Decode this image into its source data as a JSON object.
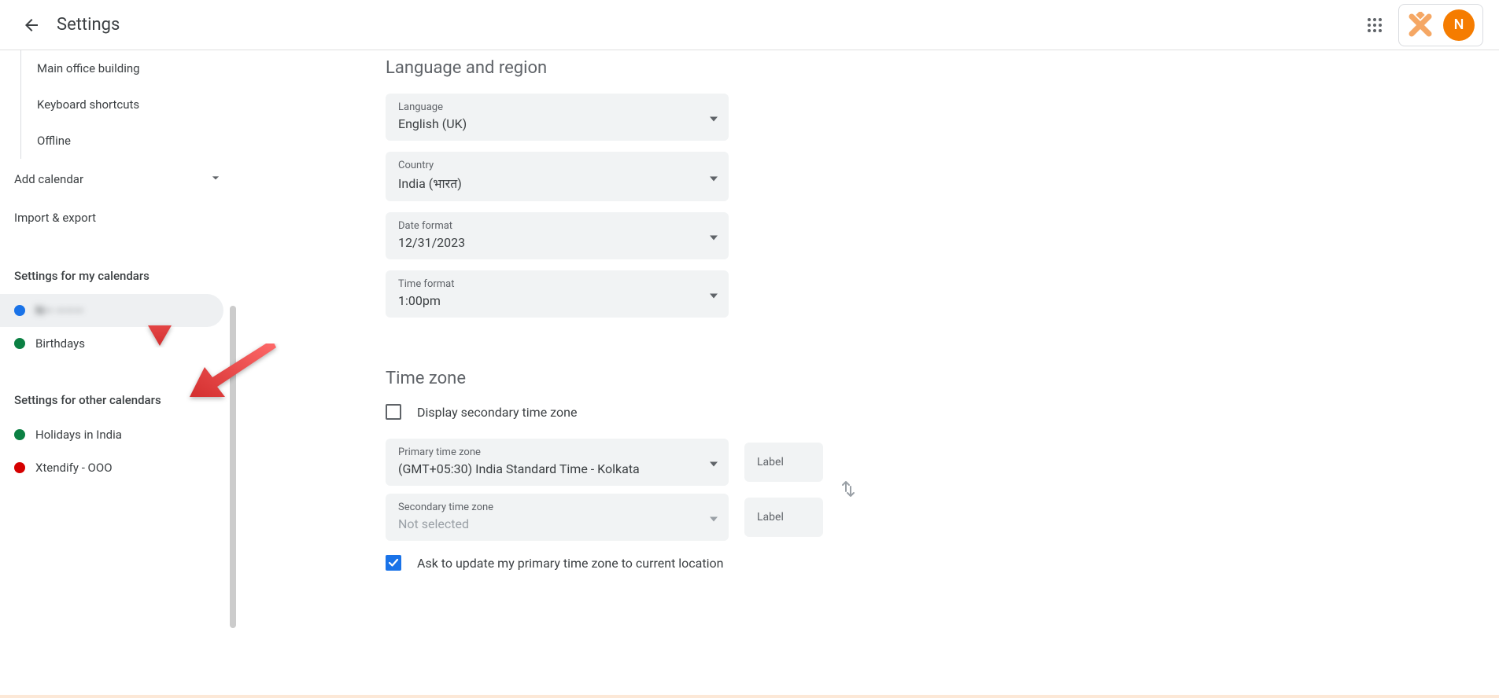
{
  "header": {
    "title": "Settings",
    "avatar_letter": "N"
  },
  "sidebar": {
    "general_items": [
      "Main office building",
      "Keyboard shortcuts",
      "Offline"
    ],
    "add_calendar": "Add calendar",
    "import_export": "Import & export",
    "my_cal_heading": "Settings for my calendars",
    "my_calendars": [
      {
        "label": "N—  ———",
        "color": "#1a73e8",
        "blur": true,
        "highlighted": true
      },
      {
        "label": "Birthdays",
        "color": "#0b8043",
        "blur": false,
        "highlighted": false
      }
    ],
    "other_cal_heading": "Settings for other calendars",
    "other_calendars": [
      {
        "label": "Holidays in India",
        "color": "#0b8043"
      },
      {
        "label": "Xtendify - OOO",
        "color": "#d50000"
      }
    ]
  },
  "language_region": {
    "heading": "Language and region",
    "language": {
      "label": "Language",
      "value": "English (UK)"
    },
    "country": {
      "label": "Country",
      "value": "India (भारत)"
    },
    "date_format": {
      "label": "Date format",
      "value": "12/31/2023"
    },
    "time_format": {
      "label": "Time format",
      "value": "1:00pm"
    }
  },
  "timezone": {
    "heading": "Time zone",
    "display_secondary_label": "Display secondary time zone",
    "display_secondary_checked": false,
    "primary": {
      "label": "Primary time zone",
      "value": "(GMT+05:30) India Standard Time - Kolkata"
    },
    "primary_label_field": "Label",
    "secondary": {
      "label": "Secondary time zone",
      "value": "Not selected"
    },
    "secondary_label_field": "Label",
    "ask_update_checked": true,
    "ask_update_label": "Ask to update my primary time zone to current location"
  }
}
